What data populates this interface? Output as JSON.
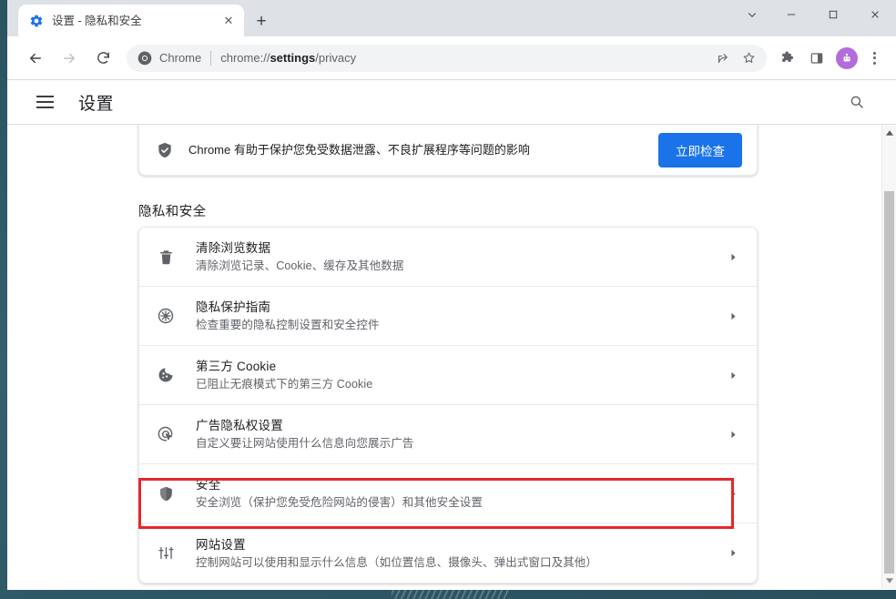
{
  "window": {
    "controls": {
      "tab_search": "tab-search-chevron",
      "minimize": "—",
      "maximize": "▢",
      "close": "✕"
    }
  },
  "tabstrip": {
    "tabs": [
      {
        "favicon": "settings-gear-icon",
        "title": "设置 - 隐私和安全",
        "close_label": "✕"
      }
    ],
    "new_tab_label": "+"
  },
  "toolbar": {
    "back_icon": "back-arrow-icon",
    "forward_icon": "forward-arrow-icon",
    "reload_icon": "reload-icon",
    "omnibox": {
      "site_icon": "chrome-logo-icon",
      "chip_label": "Chrome",
      "url_prefix": "chrome://",
      "url_bold": "settings",
      "url_suffix": "/privacy",
      "share_icon": "share-icon",
      "bookmark_icon": "star-icon"
    },
    "extensions_icon": "puzzle-piece-icon",
    "side_panel_icon": "side-panel-icon",
    "avatar_icon": "profile-avatar-icon",
    "menu_icon": "three-dot-menu-icon"
  },
  "settings_header": {
    "menu_icon": "hamburger-menu-icon",
    "title": "设置",
    "search_icon": "search-icon"
  },
  "safety_check": {
    "icon": "shield-check-icon",
    "message": "Chrome 有助于保护您免受数据泄露、不良扩展程序等问题的影响",
    "button_label": "立即检查"
  },
  "privacy_section": {
    "heading": "隐私和安全",
    "rows": [
      {
        "icon": "trash-bin-icon",
        "title": "清除浏览数据",
        "subtitle": "清除浏览记录、Cookie、缓存及其他数据",
        "chevron": "▸"
      },
      {
        "icon": "privacy-guide-icon",
        "title": "隐私保护指南",
        "subtitle": "检查重要的隐私控制设置和安全控件",
        "chevron": "▸"
      },
      {
        "icon": "cookie-icon",
        "title": "第三方 Cookie",
        "subtitle": "已阻止无痕模式下的第三方 Cookie",
        "chevron": "▸"
      },
      {
        "icon": "ad-privacy-icon",
        "title": "广告隐私权设置",
        "subtitle": "自定义要让网站使用什么信息向您展示广告",
        "chevron": "▸"
      },
      {
        "icon": "shield-icon",
        "title": "安全",
        "subtitle": "安全浏览（保护您免受危险网站的侵害）和其他安全设置",
        "chevron": "▸"
      },
      {
        "icon": "sliders-icon",
        "title": "网站设置",
        "subtitle": "控制网站可以使用和显示什么信息（如位置信息、摄像头、弹出式窗口及其他）",
        "chevron": "▸"
      }
    ]
  },
  "annotation": {
    "highlight_color": "#e8262a",
    "target": "安全"
  },
  "scrollbar": {
    "up_arrow": "▲",
    "down_arrow": "▼"
  },
  "colors": {
    "accent_blue": "#1a73e8",
    "avatar_purple": "#b36ddb",
    "highlight_red": "#e8262a",
    "tabstrip_gray": "#dee1e6"
  }
}
